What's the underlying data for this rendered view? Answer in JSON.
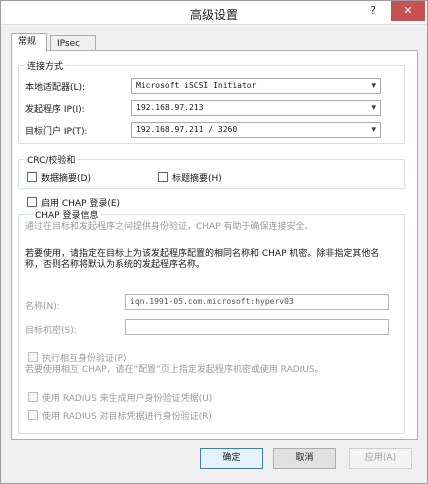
{
  "window": {
    "title": "高级设置",
    "help_glyph": "?",
    "close_glyph": "✕"
  },
  "tabs": [
    {
      "label": "常规",
      "active": true
    },
    {
      "label": "IPsec",
      "active": false
    }
  ],
  "connect_group": {
    "title": "连接方式",
    "adapter_label": "本地适配器(L):",
    "adapter_value": "Microsoft iSCSI Initiator",
    "initiator_label": "发起程序 IP(I):",
    "initiator_value": "192.168.97.213",
    "portal_label": "目标门户 IP(T):",
    "portal_value": "192.168.97.211 / 3260"
  },
  "crc_group": {
    "title": "CRC/校验和",
    "data_digest_label": "数据摘要(D)",
    "header_digest_label": "标题摘要(H)"
  },
  "chap": {
    "enable_label": "启用 CHAP 登录(E)",
    "group_title": "CHAP 登录信息",
    "desc1": "通过在目标和发起程序之间提供身份验证，CHAP 有助于确保连接安全。",
    "desc2": "若要使用，请指定在目标上为该发起程序配置的相同名称和 CHAP 机密。除非指定其他名称，否则名称将默认为系统的发起程序名称。",
    "name_label": "名称(N):",
    "name_value": "iqn.1991-05.com.microsoft:hyperv03",
    "secret_label": "目标机密(S):",
    "secret_value": "",
    "mutual_label": "执行相互身份验证(P)",
    "mutual_desc": "若要使用相互 CHAP，请在“配置”页上指定发起程序机密或使用 RADIUS。",
    "radius_user_label": "使用 RADIUS 来生成用户身份验证凭据(U)",
    "radius_target_label": "使用 RADIUS 对目标凭据进行身份验证(R)"
  },
  "buttons": {
    "ok": "确定",
    "cancel": "取消",
    "apply": "应用(A)"
  },
  "icons": {
    "dropdown": "▾"
  }
}
